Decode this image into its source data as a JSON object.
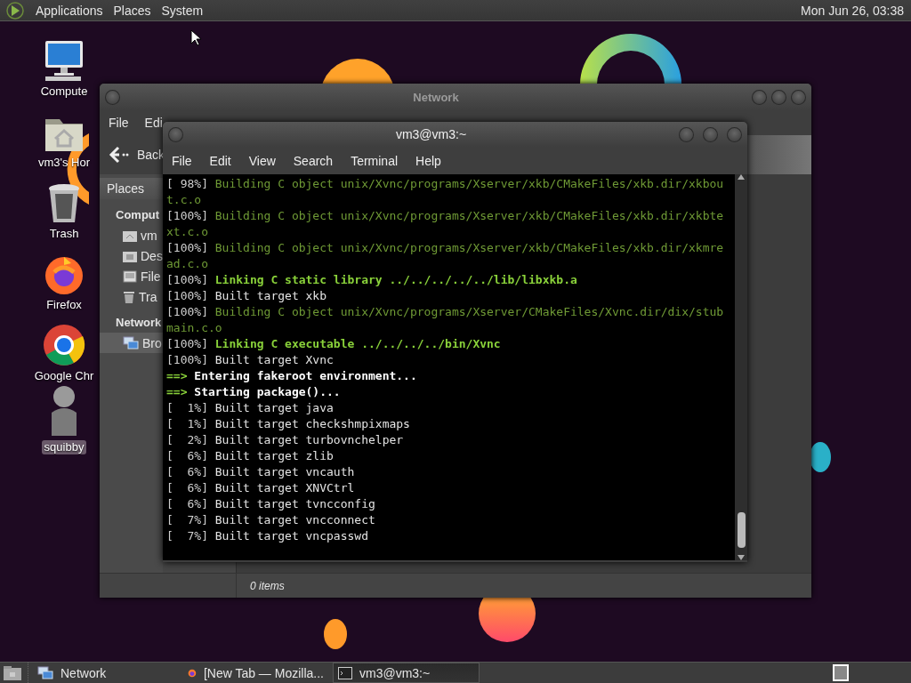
{
  "top_panel": {
    "menus": [
      "Applications",
      "Places",
      "System"
    ],
    "clock": "Mon Jun 26, 03:38"
  },
  "desktop_icons": [
    {
      "kind": "computer",
      "label": "Compute",
      "selected": false
    },
    {
      "kind": "home",
      "label": "vm3's Hor",
      "selected": false
    },
    {
      "kind": "trash",
      "label": "Trash",
      "selected": false
    },
    {
      "kind": "firefox",
      "label": "Firefox",
      "selected": false
    },
    {
      "kind": "chrome",
      "label": "Google Chr",
      "selected": false
    },
    {
      "kind": "figure",
      "label": "squibby",
      "selected": true
    }
  ],
  "file_window": {
    "title": "Network",
    "menu": [
      "File",
      "Edi"
    ],
    "back": "Back",
    "sidebar_tab": "Places",
    "sections": [
      {
        "heading": "Comput",
        "items": [
          {
            "kind": "home",
            "label": "vm",
            "selected": false
          },
          {
            "kind": "desktop",
            "label": "Des",
            "selected": false
          },
          {
            "kind": "drive",
            "label": "File",
            "selected": false
          },
          {
            "kind": "trash",
            "label": "Tra",
            "selected": false
          }
        ]
      },
      {
        "heading": "Network",
        "items": [
          {
            "kind": "network",
            "label": "Bro",
            "selected": true
          }
        ]
      }
    ],
    "status": "0 items"
  },
  "terminal": {
    "title": "vm3@vm3:~",
    "menu": [
      "File",
      "Edit",
      "View",
      "Search",
      "Terminal",
      "Help"
    ],
    "lines": [
      {
        "kind": "building",
        "prefix": "[ 98%]",
        "text": "Building C object unix/Xvnc/programs/Xserver/xkb/CMakeFiles/xkb.dir/xkbou"
      },
      {
        "kind": "wrap",
        "text": "t.c.o"
      },
      {
        "kind": "building",
        "prefix": "[100%]",
        "text": "Building C object unix/Xvnc/programs/Xserver/xkb/CMakeFiles/xkb.dir/xkbte"
      },
      {
        "kind": "wrap",
        "text": "xt.c.o"
      },
      {
        "kind": "building",
        "prefix": "[100%]",
        "text": "Building C object unix/Xvnc/programs/Xserver/xkb/CMakeFiles/xkb.dir/xkmre"
      },
      {
        "kind": "wrap",
        "text": "ad.c.o"
      },
      {
        "kind": "linking",
        "prefix": "[100%]",
        "text": "Linking C static library ../../../../../lib/libxkb.a"
      },
      {
        "kind": "built",
        "prefix": "[100%]",
        "text": "Built target xkb"
      },
      {
        "kind": "building",
        "prefix": "[100%]",
        "text": "Building C object unix/Xvnc/programs/Xserver/CMakeFiles/Xvnc.dir/dix/stub"
      },
      {
        "kind": "wrap",
        "text": "main.c.o"
      },
      {
        "kind": "linking",
        "prefix": "[100%]",
        "text": "Linking C executable ../../../../bin/Xvnc"
      },
      {
        "kind": "built",
        "prefix": "[100%]",
        "text": "Built target Xvnc"
      },
      {
        "kind": "step",
        "prefix": "==>",
        "text": "Entering fakeroot environment..."
      },
      {
        "kind": "step",
        "prefix": "==>",
        "text": "Starting package()..."
      },
      {
        "kind": "built",
        "prefix": "[  1%]",
        "text": "Built target java"
      },
      {
        "kind": "built",
        "prefix": "[  1%]",
        "text": "Built target checkshmpixmaps"
      },
      {
        "kind": "built",
        "prefix": "[  2%]",
        "text": "Built target turbovnchelper"
      },
      {
        "kind": "built",
        "prefix": "[  6%]",
        "text": "Built target zlib"
      },
      {
        "kind": "built",
        "prefix": "[  6%]",
        "text": "Built target vncauth"
      },
      {
        "kind": "built",
        "prefix": "[  6%]",
        "text": "Built target XNVCtrl"
      },
      {
        "kind": "built",
        "prefix": "[  6%]",
        "text": "Built target tvncconfig"
      },
      {
        "kind": "built",
        "prefix": "[  7%]",
        "text": "Built target vncconnect"
      },
      {
        "kind": "built",
        "prefix": "[  7%]",
        "text": "Built target vncpasswd"
      }
    ]
  },
  "taskbar": {
    "tasks": [
      {
        "kind": "network",
        "label": "Network",
        "selected": false
      },
      {
        "kind": "firefox",
        "label": "[New Tab — Mozilla...",
        "selected": false
      },
      {
        "kind": "terminal",
        "label": "vm3@vm3:~",
        "selected": true
      }
    ]
  }
}
